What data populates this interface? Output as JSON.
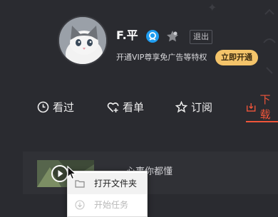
{
  "profile": {
    "username": "F.平",
    "logout_label": "退出",
    "vip_promo": "开通VIP尊享免广告等特权",
    "vip_open_label": "立即开通",
    "verified_icon": "verified-badge-icon",
    "level_icon": "level-star-icon"
  },
  "tabs": [
    {
      "label": "看过",
      "icon": "clock-icon"
    },
    {
      "label": "看单",
      "icon": "heart-plus-icon"
    },
    {
      "label": "订阅",
      "icon": "star-icon"
    },
    {
      "label": "下载",
      "icon": "download-icon",
      "active": true
    }
  ],
  "downloads": [
    {
      "title": "心事你都懂"
    }
  ],
  "context_menu": {
    "items": [
      {
        "label": "打开文件夹",
        "icon": "folder-icon",
        "enabled": true
      },
      {
        "label": "开始任务",
        "icon": "download-arrow-icon",
        "enabled": false
      }
    ]
  },
  "colors": {
    "background": "#2a2b30",
    "accent": "#f0553a",
    "vip_gold": "#f4c46a",
    "verified_blue": "#1f9df0"
  }
}
